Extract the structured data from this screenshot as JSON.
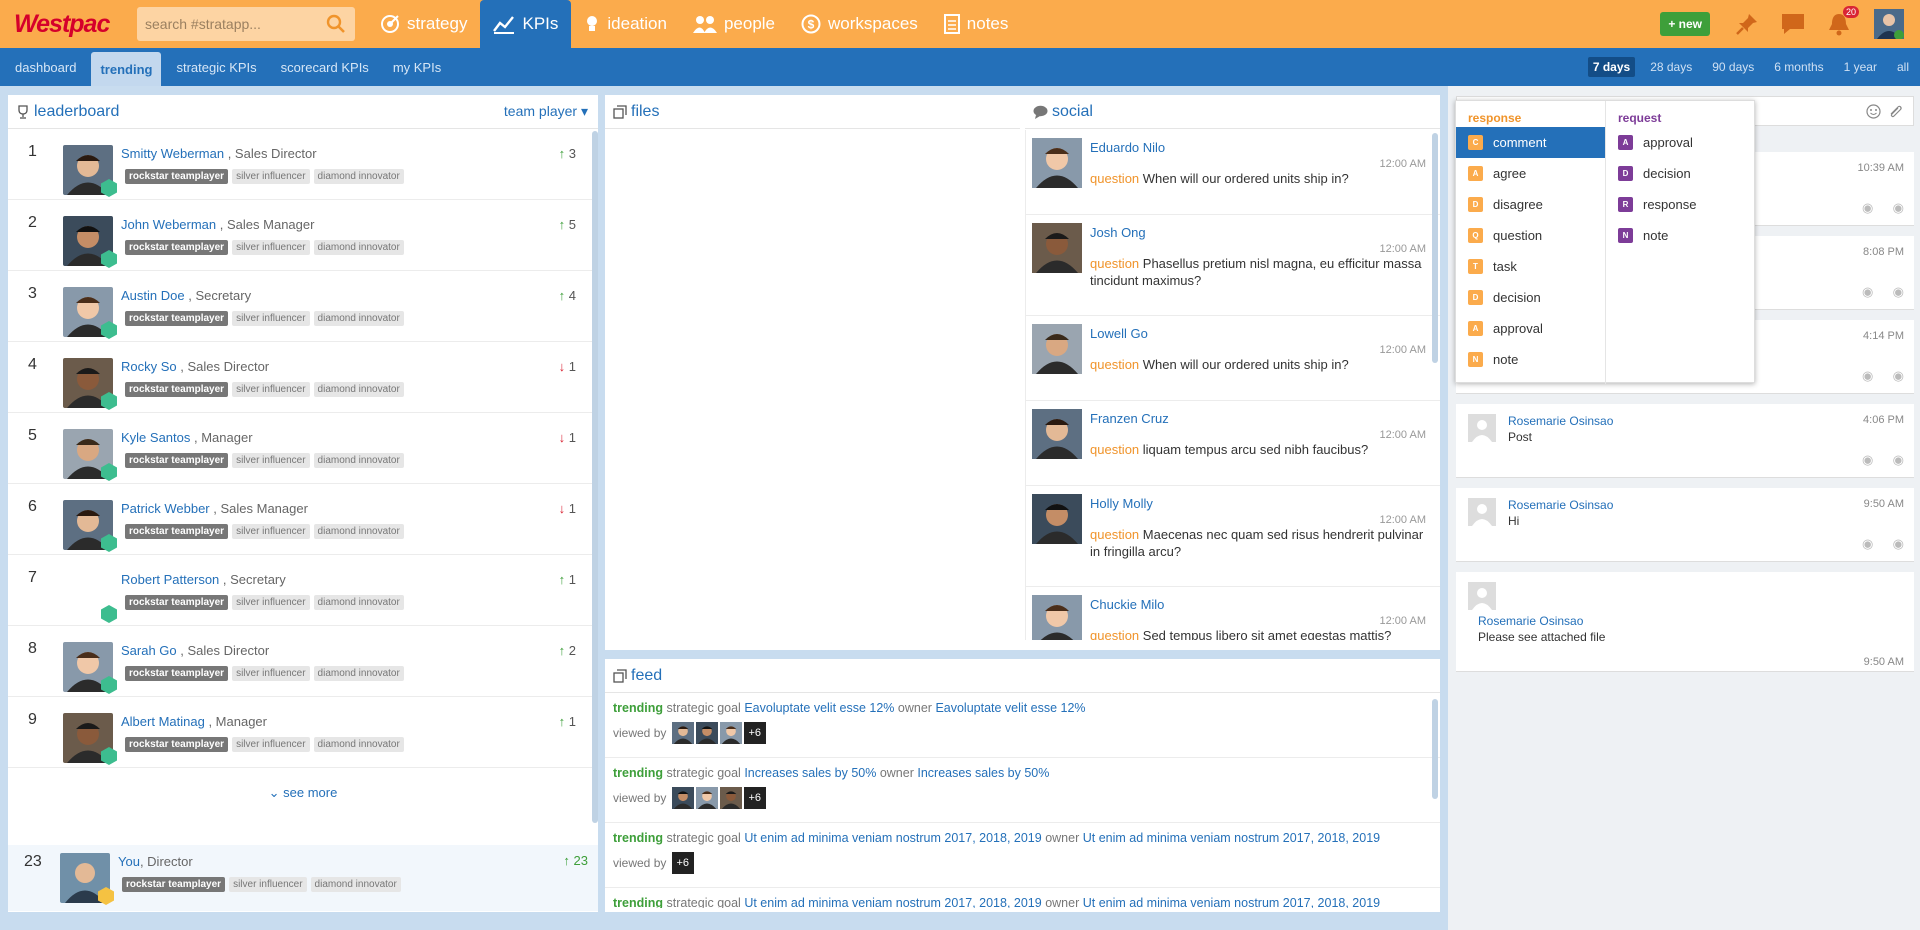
{
  "app": {
    "brand": "Westpac",
    "search_placeholder": "search #stratapp...",
    "new_label": "+ new",
    "notif_count": "20"
  },
  "nav": [
    {
      "label": "strategy",
      "icon": "strategy-icon"
    },
    {
      "label": "KPIs",
      "icon": "kpi-chart-icon",
      "active": true
    },
    {
      "label": "ideation",
      "icon": "lightbulb-icon"
    },
    {
      "label": "people",
      "icon": "people-icon"
    },
    {
      "label": "workspaces",
      "icon": "dollar-icon"
    },
    {
      "label": "notes",
      "icon": "notes-icon"
    }
  ],
  "subnav": [
    "dashboard",
    "trending",
    "strategic KPIs",
    "scorecard KPIs",
    "my KPIs"
  ],
  "ranges": [
    "7 days",
    "28 days",
    "90 days",
    "6 months",
    "1 year",
    "all"
  ],
  "leaderboard": {
    "title": "leaderboard",
    "filter": "team player",
    "see_more": "see more",
    "tags": [
      "rockstar teamplayer",
      "silver influencer",
      "diamond innovator"
    ],
    "rows": [
      {
        "rank": "1",
        "name": "Smitty Weberman",
        "role": ", Sales Director",
        "trend": "3",
        "dir": "up"
      },
      {
        "rank": "2",
        "name": "John Weberman",
        "role": ", Sales Manager",
        "trend": "5",
        "dir": "up"
      },
      {
        "rank": "3",
        "name": "Austin Doe",
        "role": ", Secretary",
        "trend": "4",
        "dir": "up"
      },
      {
        "rank": "4",
        "name": "Rocky So",
        "role": ", Sales Director",
        "trend": "1",
        "dir": "down"
      },
      {
        "rank": "5",
        "name": "Kyle Santos",
        "role": ", Manager",
        "trend": "1",
        "dir": "down"
      },
      {
        "rank": "6",
        "name": "Patrick Webber",
        "role": ", Sales Manager",
        "trend": "1",
        "dir": "down"
      },
      {
        "rank": "7",
        "name": "Robert Patterson",
        "role": ", Secretary",
        "trend": "1",
        "dir": "up"
      },
      {
        "rank": "8",
        "name": "Sarah Go",
        "role": ", Sales Director",
        "trend": "2",
        "dir": "up"
      },
      {
        "rank": "9",
        "name": "Albert Matinag",
        "role": ", Manager",
        "trend": "1",
        "dir": "up"
      }
    ],
    "you": {
      "rank": "23",
      "name": "You",
      "role": ", Director",
      "trend": "23",
      "dir": "up"
    }
  },
  "files": {
    "title": "files"
  },
  "social": {
    "title": "social",
    "posts": [
      {
        "name": "Eduardo Nilo",
        "time": "12:00 AM",
        "kind": "question",
        "text": "When will our ordered units ship in?"
      },
      {
        "name": "Josh Ong",
        "time": "12:00 AM",
        "kind": "question",
        "text": "Phasellus pretium nisl magna, eu efficitur massa tincidunt maximus?"
      },
      {
        "name": "Lowell Go",
        "time": "12:00 AM",
        "kind": "question",
        "text": "When will our ordered units ship in?"
      },
      {
        "name": "Franzen Cruz",
        "time": "12:00 AM",
        "kind": "question",
        "text": "liquam tempus arcu sed nibh faucibus?"
      },
      {
        "name": "Holly Molly",
        "time": "12:00 AM",
        "kind": "question",
        "text": "Maecenas nec quam sed risus hendrerit pulvinar in fringilla arcu?"
      },
      {
        "name": "Chuckie Milo",
        "time": "12:00 AM",
        "kind": "question",
        "text": "Sed tempus libero sit amet egestas mattis?"
      }
    ]
  },
  "feed": {
    "title": "feed",
    "viewed_label": "viewed by",
    "items": [
      {
        "tag": "trending",
        "kind": "strategic goal",
        "goal": "Eavoluptate velit esse 12%",
        "owner_label": "owner",
        "owner": "Eavoluptate velit esse 12%",
        "extra": "+6"
      },
      {
        "tag": "trending",
        "kind": "strategic goal",
        "goal": "Increases sales by 50%",
        "owner_label": "owner",
        "owner": "Increases sales by 50%",
        "extra": "+6"
      },
      {
        "tag": "trending",
        "kind": "strategic goal",
        "goal": "Ut enim ad minima veniam nostrum 2017, 2018, 2019",
        "owner_label": "owner",
        "owner": "Ut enim ad minima veniam nostrum 2017, 2018, 2019",
        "extra": "+6"
      },
      {
        "tag": "trending",
        "kind": "strategic goal",
        "goal": "Ut enim ad minima veniam nostrum 2017, 2018, 2019",
        "owner_label": "owner",
        "owner": "Ut enim ad minima veniam nostrum 2017, 2018, 2019",
        "extra": ""
      }
    ]
  },
  "chat": {
    "times": [
      "10:39 AM",
      "8:08 PM",
      "4:14 PM"
    ],
    "messages": [
      {
        "name": "Rosemarie Osinsao",
        "text": "Post",
        "time": "4:06 PM"
      },
      {
        "name": "Rosemarie Osinsao",
        "text": "Hi",
        "time": "9:50 AM"
      },
      {
        "name": "Rosemarie Osinsao",
        "text": "Please see attached file",
        "time": "9:50 AM"
      }
    ]
  },
  "dropdown": {
    "response_label": "response",
    "request_label": "request",
    "response": [
      {
        "l": "C",
        "t": "comment"
      },
      {
        "l": "A",
        "t": "agree"
      },
      {
        "l": "D",
        "t": "disagree"
      },
      {
        "l": "Q",
        "t": "question"
      },
      {
        "l": "T",
        "t": "task"
      },
      {
        "l": "D",
        "t": "decision"
      },
      {
        "l": "A",
        "t": "approval"
      },
      {
        "l": "N",
        "t": "note"
      }
    ],
    "request": [
      {
        "l": "A",
        "t": "approval"
      },
      {
        "l": "D",
        "t": "decision"
      },
      {
        "l": "R",
        "t": "response"
      },
      {
        "l": "N",
        "t": "note"
      }
    ]
  },
  "colors": {
    "orange": "#fbab4c",
    "blue": "#2470b9",
    "green": "#3e9f3a",
    "red": "#d92534",
    "purple": "#7d3c98"
  }
}
